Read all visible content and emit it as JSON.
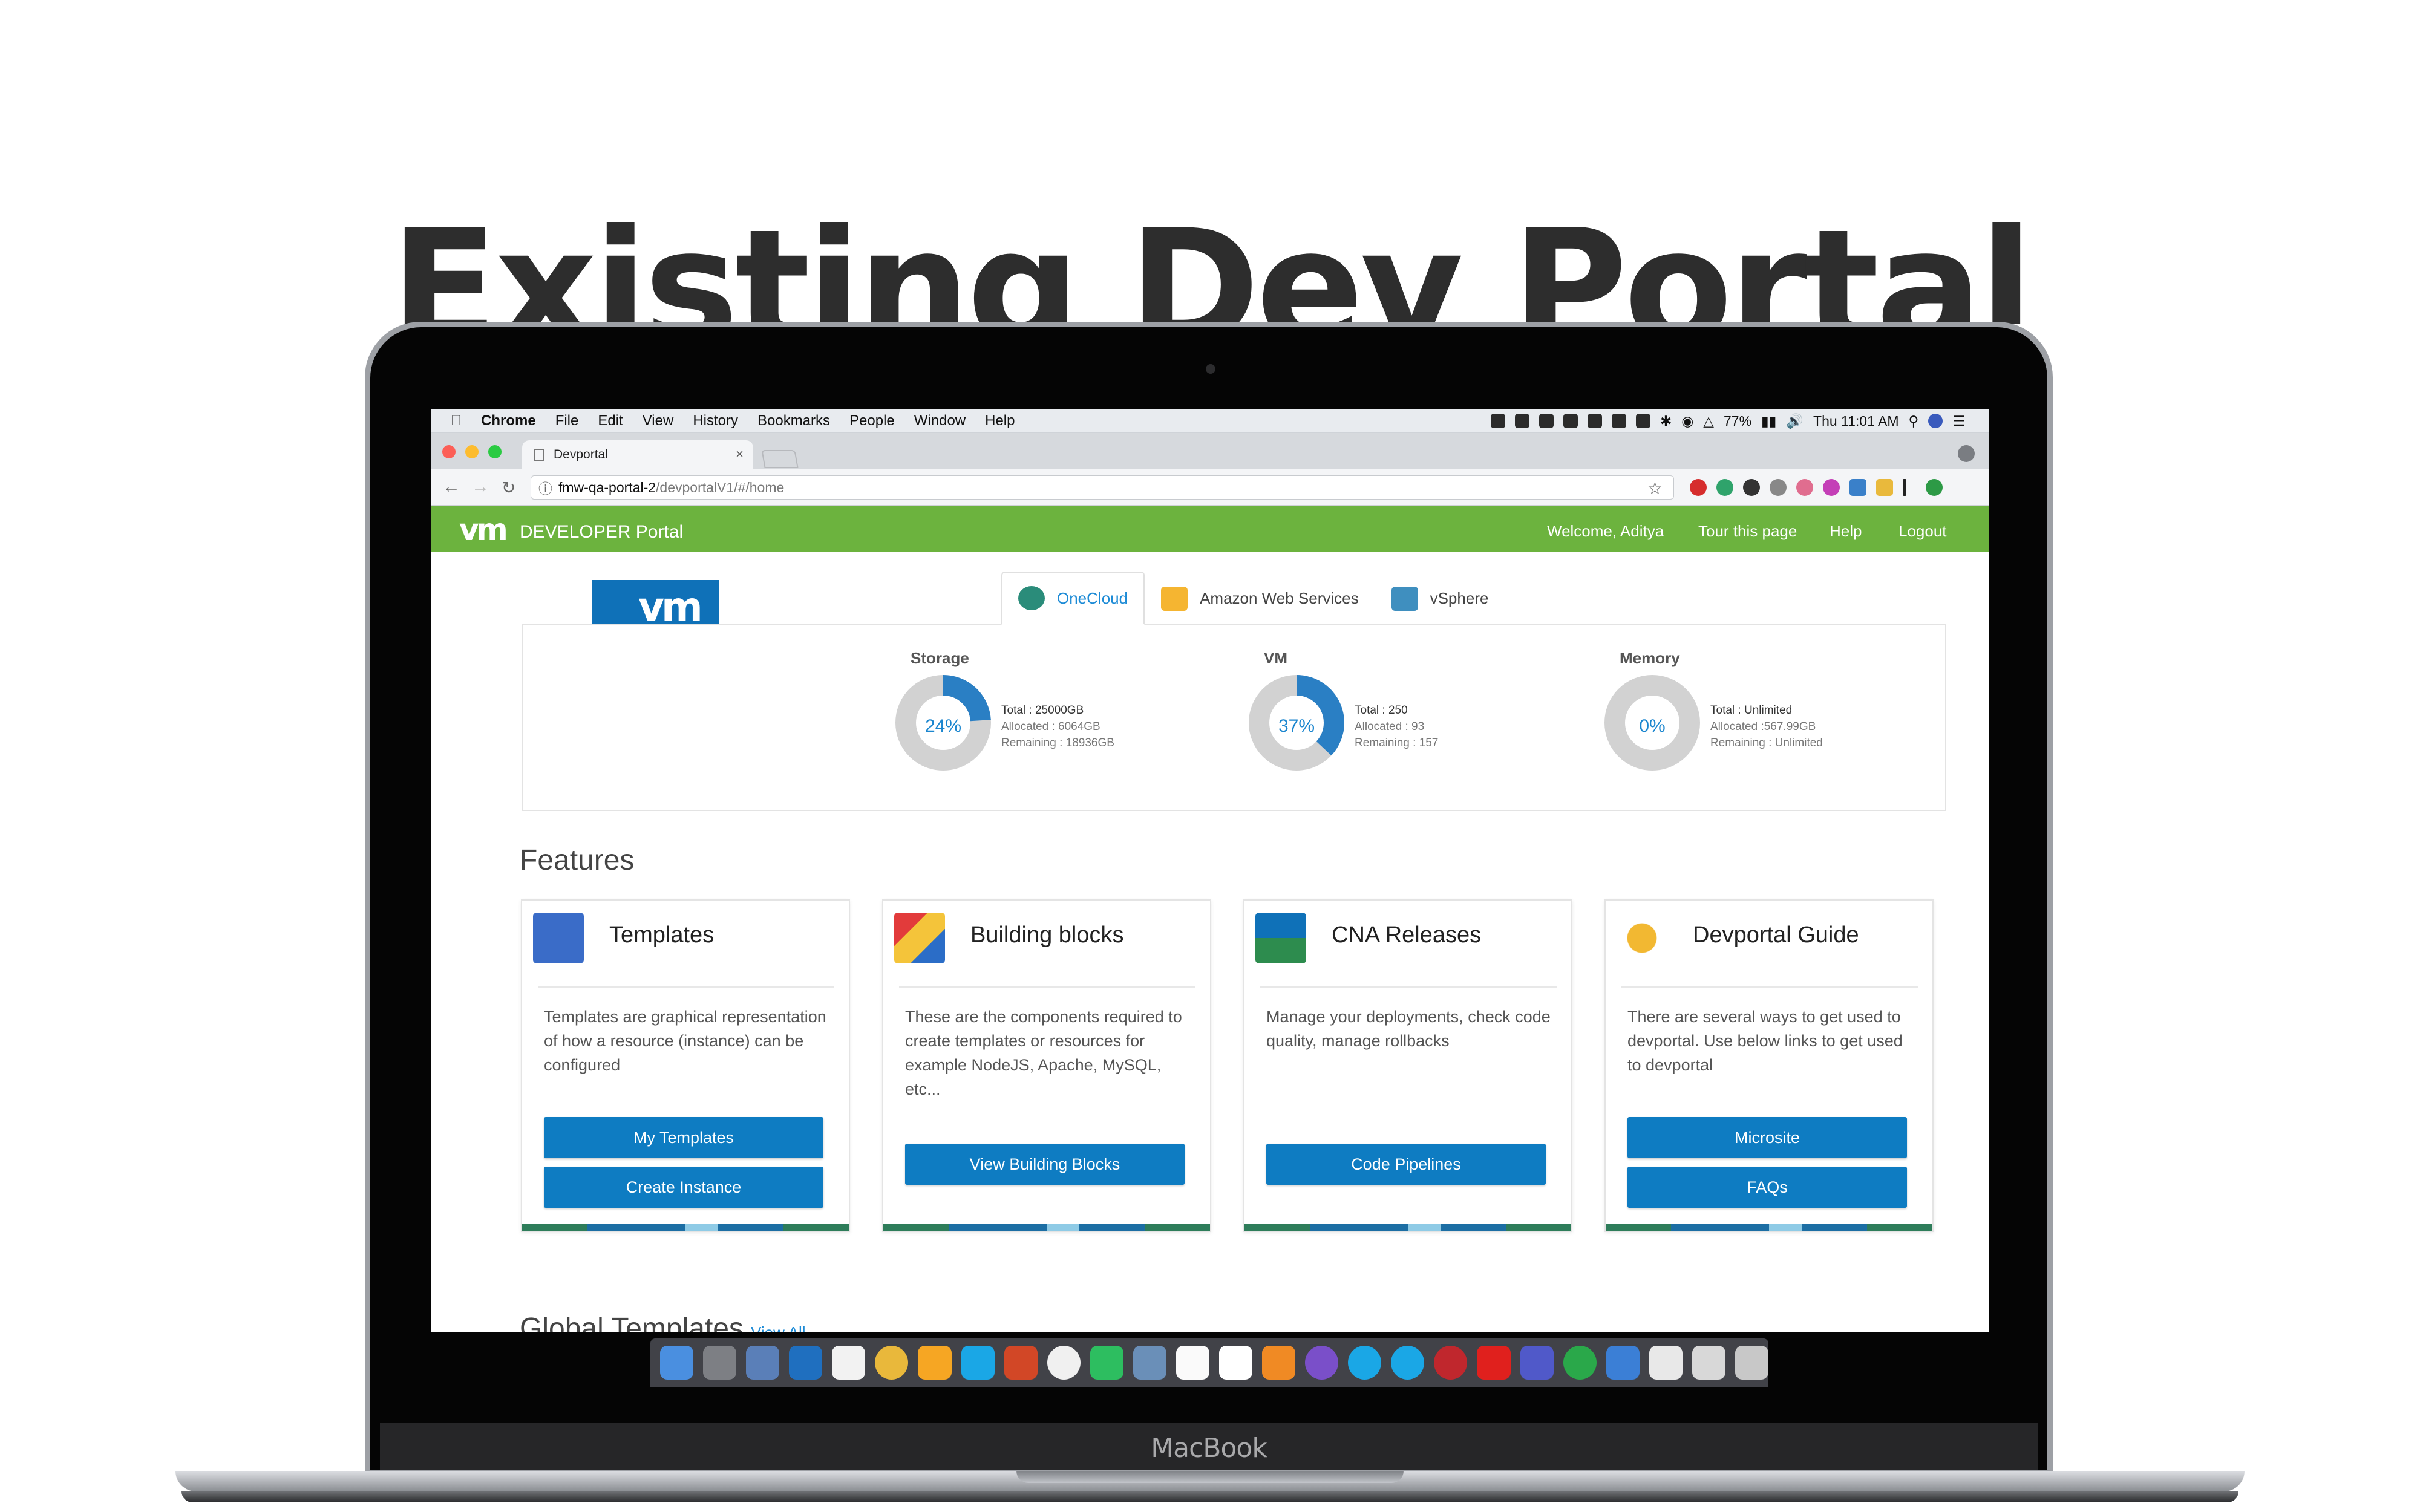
{
  "heading": "Existing Dev Portal",
  "device_label": "MacBook",
  "mac_menubar": {
    "app": "Chrome",
    "items": [
      "File",
      "Edit",
      "View",
      "History",
      "Bookmarks",
      "People",
      "Window",
      "Help"
    ],
    "battery": "77%",
    "clock": "Thu 11:01 AM"
  },
  "browser": {
    "tab_title": "Devportal",
    "tab_close": "×",
    "url_host": "fmw-qa-portal-2",
    "url_path": "/devportalV1/#/home"
  },
  "header": {
    "logo": "vm",
    "title": "DEVELOPER Portal",
    "nav": [
      "Welcome, Aditya",
      "Tour this page",
      "Help",
      "Logout"
    ]
  },
  "product_logo_text": "vm",
  "cloud_tabs": [
    {
      "label": "OneCloud",
      "active": true,
      "icon": "onecloud-icon"
    },
    {
      "label": "Amazon Web Services",
      "active": false,
      "icon": "aws-icon"
    },
    {
      "label": "vSphere",
      "active": false,
      "icon": "vsphere-icon"
    }
  ],
  "stats": [
    {
      "label": "Storage",
      "percent": "24%",
      "fraction": 0.24,
      "total": "Total : 25000GB",
      "allocated": "Allocated : 6064GB",
      "remaining": "Remaining : 18936GB"
    },
    {
      "label": "VM",
      "percent": "37%",
      "fraction": 0.37,
      "total": "Total : 250",
      "allocated": "Allocated : 93",
      "remaining": "Remaining : 157"
    },
    {
      "label": "Memory",
      "percent": "0%",
      "fraction": 0,
      "total": "Total : Unlimited",
      "allocated": "Allocated :567.99GB",
      "remaining": "Remaining : Unlimited"
    }
  ],
  "features_heading": "Features",
  "features": [
    {
      "title": "Templates",
      "description": "Templates are graphical representation of how a resource (instance) can be configured",
      "buttons": [
        "My Templates",
        "Create Instance"
      ]
    },
    {
      "title": "Building blocks",
      "description": "These are the components required to create templates or resources for example NodeJS, Apache, MySQL, etc...",
      "buttons": [
        "View Building Blocks"
      ]
    },
    {
      "title": "CNA Releases",
      "description": "Manage your deployments, check code quality, manage rollbacks",
      "buttons": [
        "Code Pipelines"
      ]
    },
    {
      "title": "Devportal Guide",
      "description": "There are several ways to get used to devportal. Use below links to get used to devportal",
      "buttons": [
        "Microsite",
        "FAQs"
      ]
    }
  ],
  "global_templates": {
    "heading": "Global Templates",
    "view_all": "View All"
  },
  "colors": {
    "brand_green": "#6cb33e",
    "button_blue": "#0e7cc2",
    "link_blue": "#1d8bd6",
    "donut_gray": "#d2d2d2"
  }
}
